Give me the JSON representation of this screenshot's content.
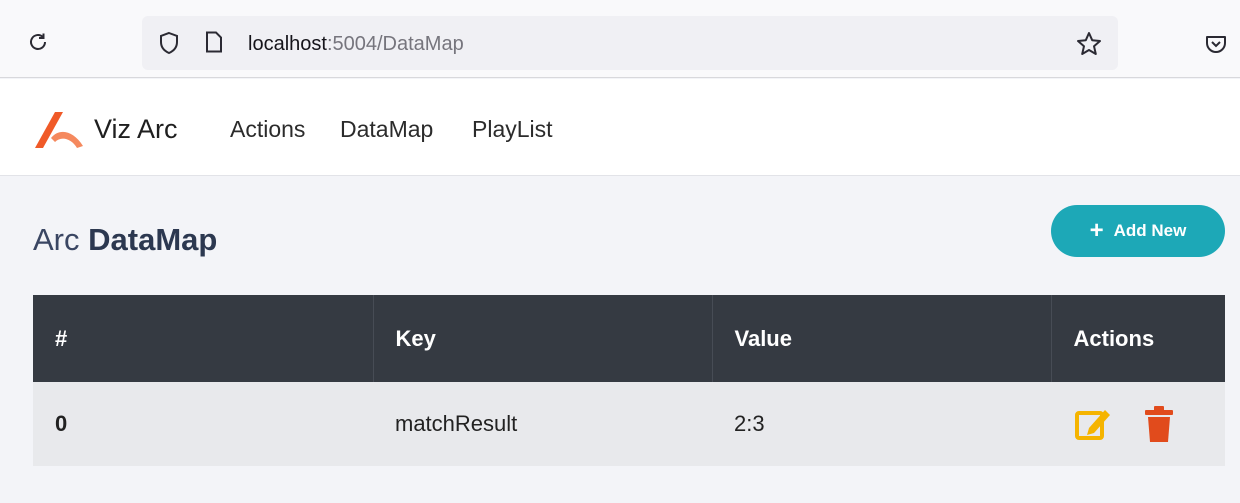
{
  "browser": {
    "url_host": "localhost",
    "url_rest": ":5004/DataMap"
  },
  "navbar": {
    "brand": "Viz Arc",
    "links": [
      "Actions",
      "DataMap",
      "PlayList"
    ]
  },
  "page": {
    "title_prefix": "Arc",
    "title_bold": "DataMap",
    "add_button_label": "Add New"
  },
  "table": {
    "headers": [
      "#",
      "Key",
      "Value",
      "Actions"
    ],
    "rows": [
      {
        "index": "0",
        "key": "matchResult",
        "value": "2:3",
        "actions": [
          "edit-icon",
          "delete-icon"
        ]
      }
    ]
  },
  "colors": {
    "accent": "#1da8b7",
    "header_bg": "#353a42",
    "edit": "#f5b400",
    "delete": "#e14b1c",
    "brand_orange": "#f05a28"
  }
}
